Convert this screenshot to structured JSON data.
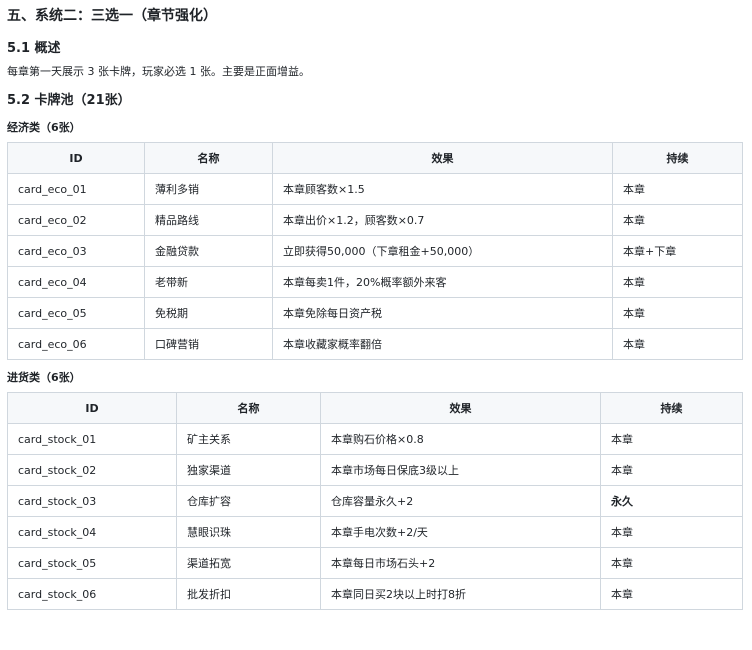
{
  "section_title": "五、系统二：三选一（章节强化）",
  "overview": {
    "heading": "5.1 概述",
    "text": "每章第一天展示 3 张卡牌，玩家必选 1 张。主要是正面增益。"
  },
  "pool": {
    "heading": "5.2 卡牌池（21张）",
    "categories": [
      {
        "title": "经济类（6张）",
        "headers": [
          "ID",
          "名称",
          "效果",
          "持续"
        ],
        "rows": [
          [
            "card_eco_01",
            "薄利多销",
            "本章顾客数×1.5",
            "本章"
          ],
          [
            "card_eco_02",
            "精品路线",
            "本章出价×1.2，顾客数×0.7",
            "本章"
          ],
          [
            "card_eco_03",
            "金融贷款",
            "立即获得50,000（下章租金+50,000）",
            "本章+下章"
          ],
          [
            "card_eco_04",
            "老带新",
            "本章每卖1件，20%概率额外来客",
            "本章"
          ],
          [
            "card_eco_05",
            "免税期",
            "本章免除每日资产税",
            "本章"
          ],
          [
            "card_eco_06",
            "口碑营销",
            "本章收藏家概率翻倍",
            "本章"
          ]
        ]
      },
      {
        "title": "进货类（6张）",
        "headers": [
          "ID",
          "名称",
          "效果",
          "持续"
        ],
        "rows": [
          [
            "card_stock_01",
            "矿主关系",
            "本章购石价格×0.8",
            "本章"
          ],
          [
            "card_stock_02",
            "独家渠道",
            "本章市场每日保底3级以上",
            "本章"
          ],
          [
            "card_stock_03",
            "仓库扩容",
            "仓库容量永久+2",
            "永久"
          ],
          [
            "card_stock_04",
            "慧眼识珠",
            "本章手电次数+2/天",
            "本章"
          ],
          [
            "card_stock_05",
            "渠道拓宽",
            "本章每日市场石头+2",
            "本章"
          ],
          [
            "card_stock_06",
            "批发折扣",
            "本章同日买2块以上时打8折",
            "本章"
          ]
        ]
      }
    ]
  }
}
